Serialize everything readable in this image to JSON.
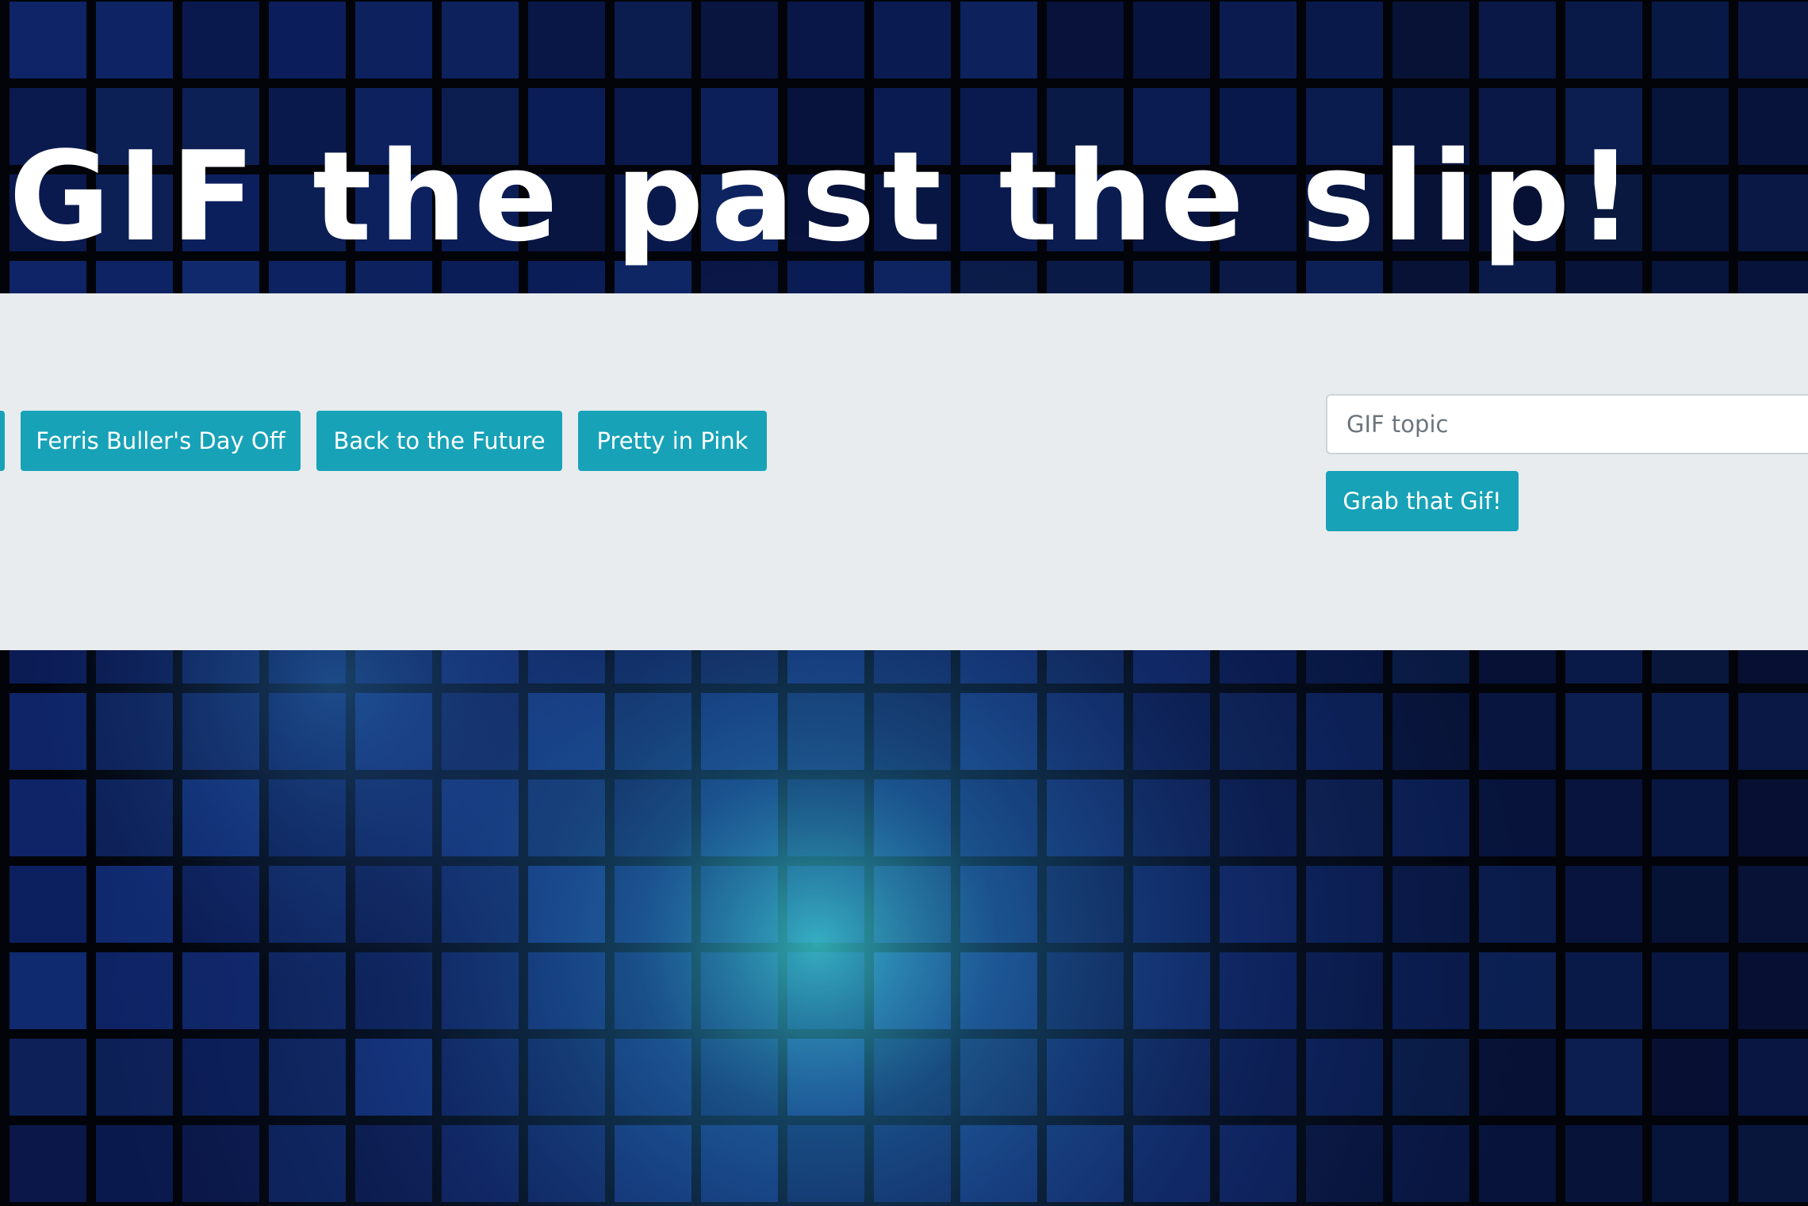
{
  "page": {
    "title": "GIF the past the slip!"
  },
  "topic_buttons": [
    {
      "label": "Ferris Buller's Day Off"
    },
    {
      "label": "Back to the Future"
    },
    {
      "label": "Pretty in Pink"
    }
  ],
  "search": {
    "placeholder": "GIF topic",
    "value": "",
    "submit_label": "Grab that Gif!"
  },
  "colors": {
    "button": "#17a2b8",
    "panel": "#e8ecef",
    "title": "#ffffff",
    "background": "#030612"
  }
}
